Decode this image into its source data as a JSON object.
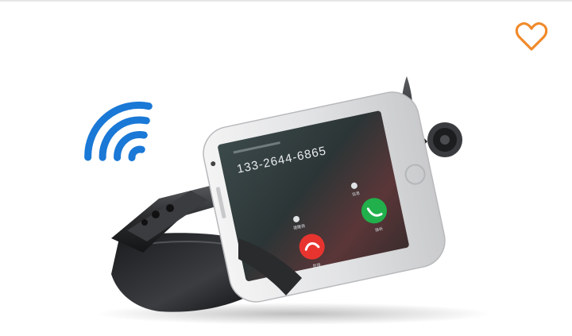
{
  "product": {
    "phone_number": "133-2644-6865",
    "decline_label": "拒接",
    "accept_label": "接听",
    "message_label": "信息",
    "remind_label": "提醒我"
  },
  "favorite": {
    "icon": "heart-outline-icon",
    "color": "#f08a2b"
  },
  "colors": {
    "wifi": "#1a78d6",
    "accept": "#21b04b",
    "decline": "#e8342f",
    "phone_frame": "#eef0f2",
    "glasses": "#2a2b2d"
  }
}
